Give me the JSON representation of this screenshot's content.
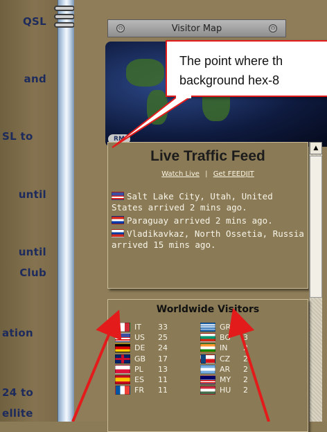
{
  "left_column": {
    "words": [
      "QSL",
      "and",
      "SL to",
      "until",
      "until",
      "Club",
      "ation",
      "24 to",
      "ellite"
    ]
  },
  "visitor_map": {
    "title": "Visitor Map",
    "logo": "RM"
  },
  "callout": {
    "line1": "The point where th",
    "line2": "background hex-8"
  },
  "traffic": {
    "title": "Live Traffic Feed",
    "watch_live": "Watch Live",
    "separator": "|",
    "get_feedjit": "Get FEEDJIT",
    "entries": [
      {
        "flag": "us",
        "text": "Salt Lake City, Utah, United States arrived 2 mins ago."
      },
      {
        "flag": "py",
        "text": "Paraguay arrived 2 mins ago."
      },
      {
        "flag": "ru",
        "text": "Vladikavkaz, North Ossetia, Russia arrived 15 mins ago."
      }
    ]
  },
  "worldwide": {
    "title": "Worldwide Visitors",
    "left": [
      {
        "code": "IT",
        "count": "33",
        "flag": "it"
      },
      {
        "code": "US",
        "count": "25",
        "flag": "us"
      },
      {
        "code": "DE",
        "count": "24",
        "flag": "de"
      },
      {
        "code": "GB",
        "count": "17",
        "flag": "gb"
      },
      {
        "code": "PL",
        "count": "13",
        "flag": "pl"
      },
      {
        "code": "ES",
        "count": "11",
        "flag": "es"
      },
      {
        "code": "FR",
        "count": "11",
        "flag": "fr"
      }
    ],
    "right": [
      {
        "code": "GR",
        "count": "3",
        "flag": "gr"
      },
      {
        "code": "BG",
        "count": "3",
        "flag": "bg"
      },
      {
        "code": "IN",
        "count": "2",
        "flag": "in"
      },
      {
        "code": "CZ",
        "count": "2",
        "flag": "cz"
      },
      {
        "code": "AR",
        "count": "2",
        "flag": "ar"
      },
      {
        "code": "MY",
        "count": "2",
        "flag": "my"
      },
      {
        "code": "HU",
        "count": "2",
        "flag": "hu"
      }
    ]
  },
  "colors": {
    "arrow": "#e31b1b",
    "panel": "#8a7a55",
    "ink": "#1d2a5c"
  }
}
